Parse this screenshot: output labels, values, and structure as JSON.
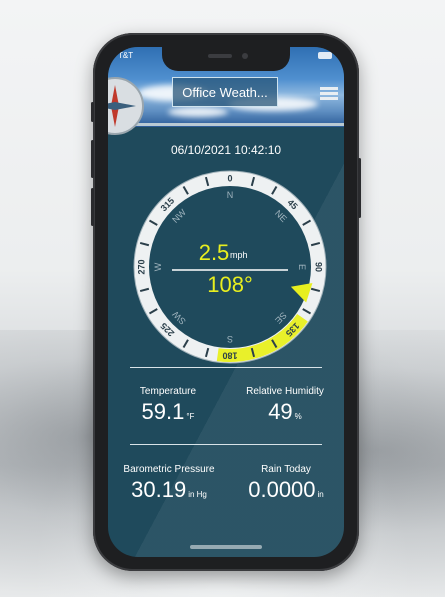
{
  "status_bar": {
    "carrier": "T&T"
  },
  "header": {
    "station_button": "Office Weath..."
  },
  "datetime": "06/10/2021 10:42:10",
  "wind": {
    "speed": "2.5",
    "speed_unit": "mph",
    "direction": "108°",
    "direction_deg": 108,
    "gust_arc_deg": [
      125,
      188
    ]
  },
  "compass": {
    "cardinals": {
      "N": "N",
      "NE": "NE",
      "E": "E",
      "SE": "SE",
      "S": "S",
      "SW": "SW",
      "W": "W",
      "NW": "NW"
    },
    "degree_labels": {
      "d0": "0",
      "d45": "45",
      "d90": "90",
      "d135": "135",
      "d180": "180",
      "d225": "225",
      "d270": "270",
      "d315": "315"
    }
  },
  "metrics": {
    "temperature": {
      "label": "Temperature",
      "value": "59.1",
      "unit": "°F"
    },
    "humidity": {
      "label": "Relative Humidity",
      "value": "49",
      "unit": "%"
    },
    "pressure": {
      "label": "Barometric Pressure",
      "value": "30.19",
      "unit": "in Hg"
    },
    "rain": {
      "label": "Rain Today",
      "value": "0.0000",
      "unit": "in"
    }
  },
  "colors": {
    "screen_bg": "#1f4a5c",
    "accent_yellow": "#e8ef1f",
    "bezel_ring": "#eef1f2",
    "text": "#ffffff"
  }
}
